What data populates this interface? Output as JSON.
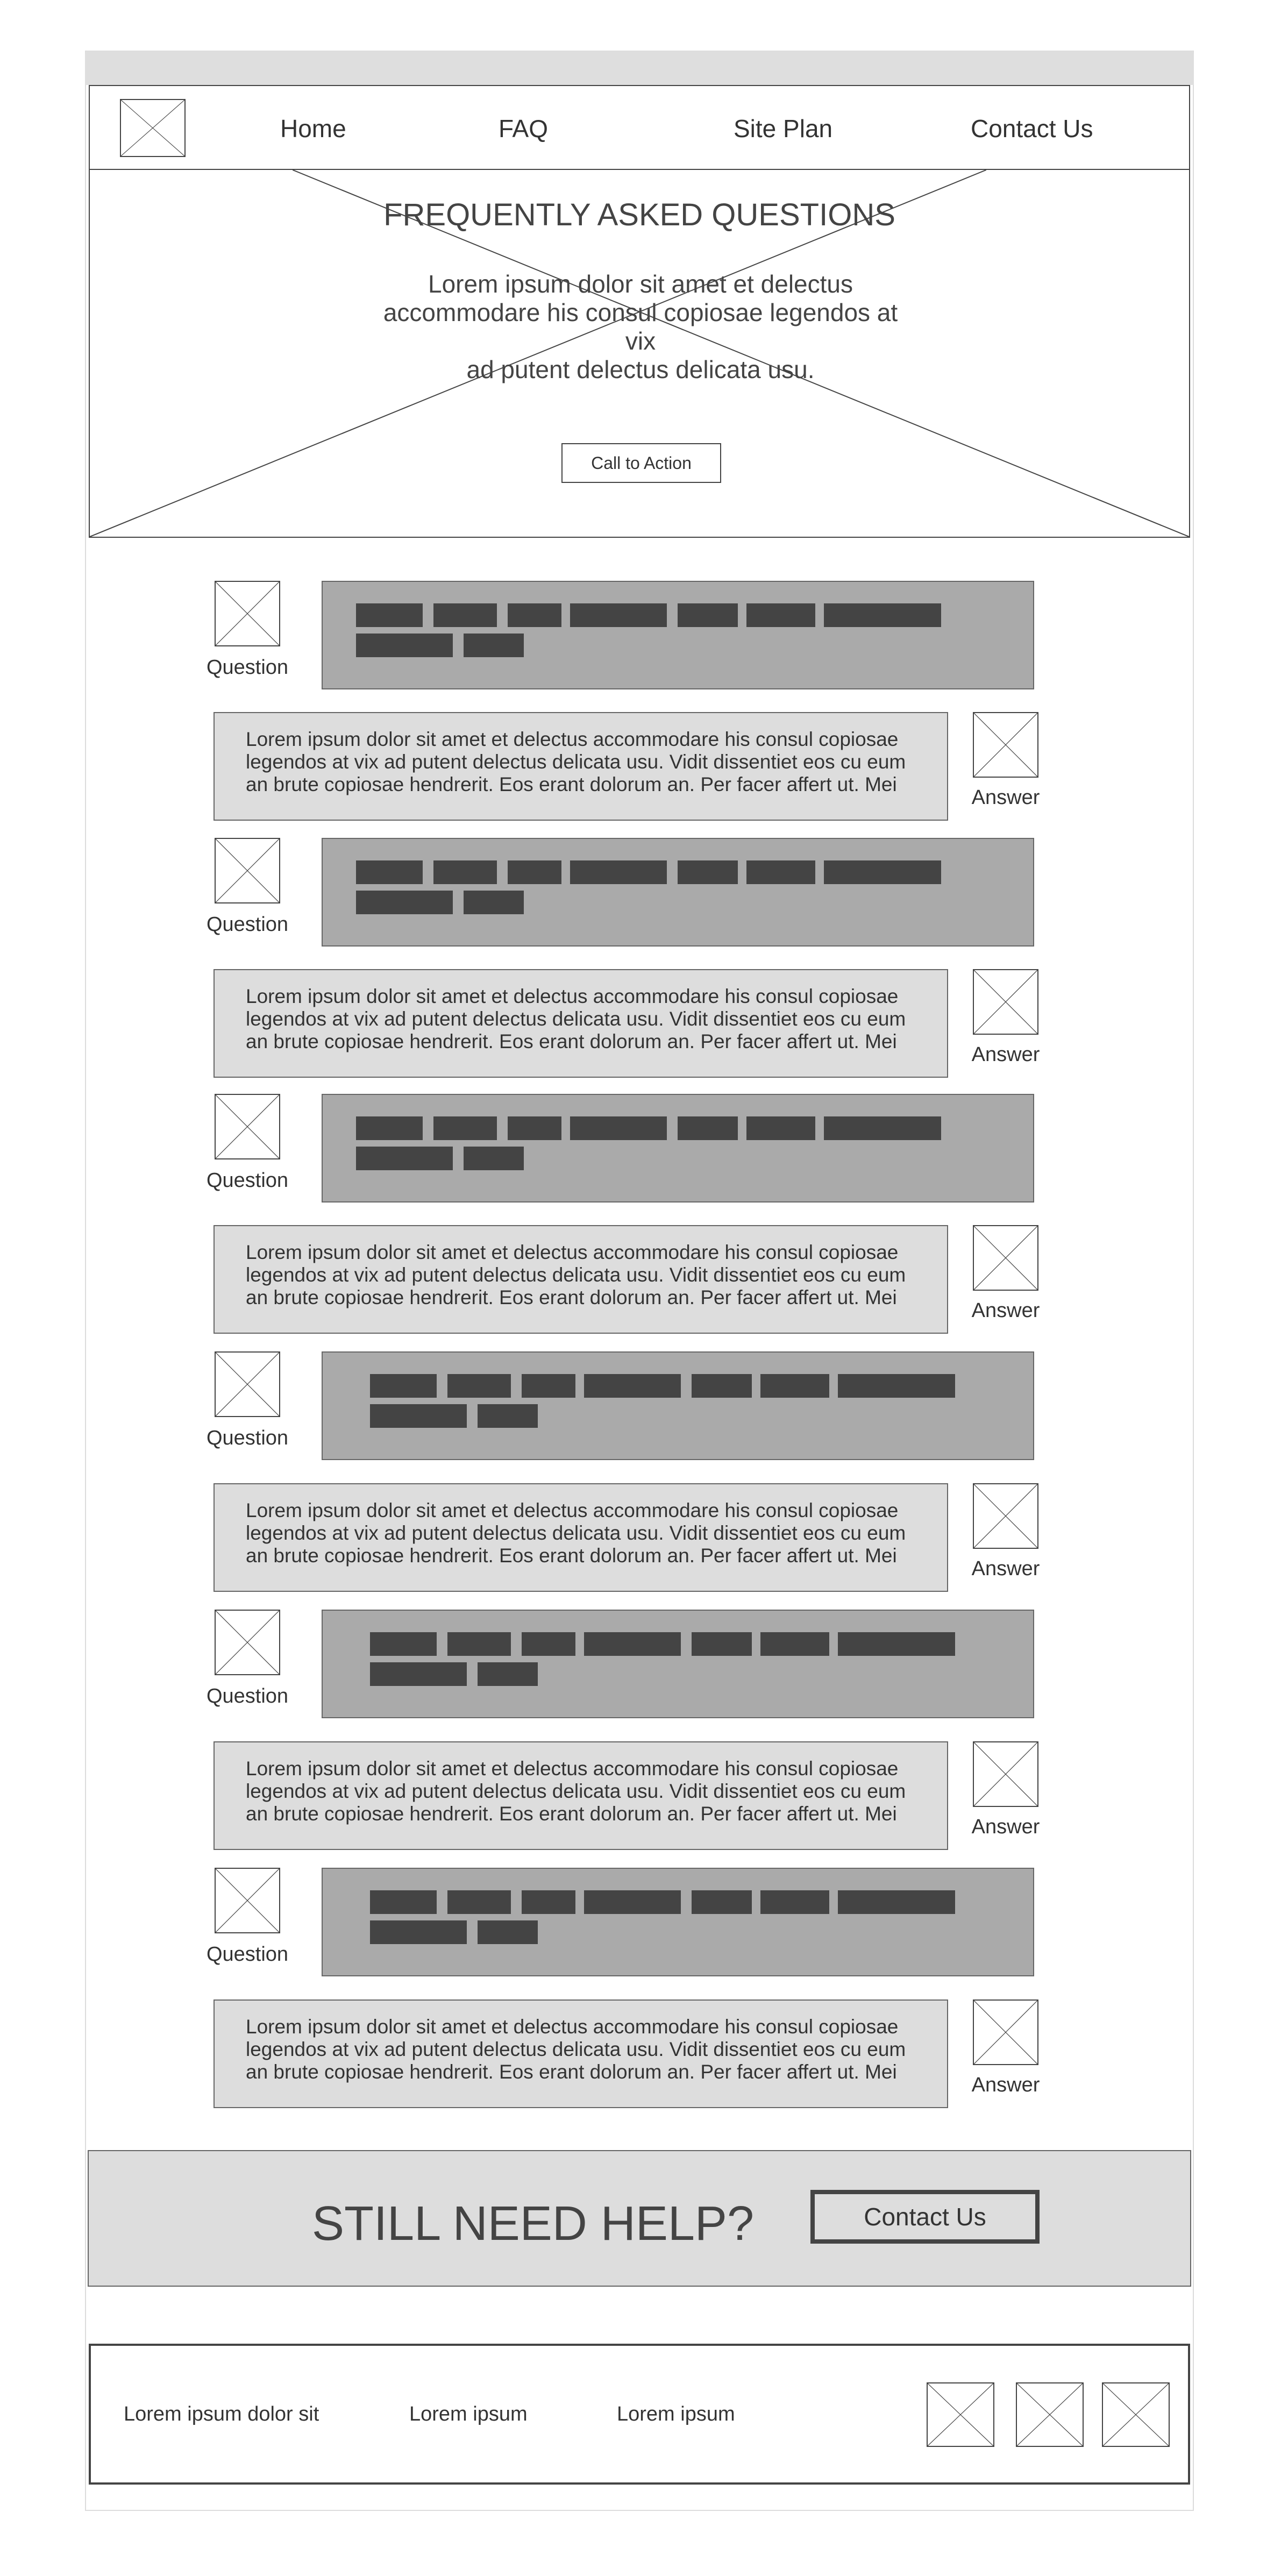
{
  "nav": {
    "logo_icon": "image-placeholder-icon",
    "items": [
      "Home",
      "FAQ",
      "Site Plan",
      "Contact Us"
    ]
  },
  "hero": {
    "title": "FREQUENTLY ASKED QUESTIONS",
    "text_lines": [
      "Lorem ipsum dolor sit amet et delectus",
      "accommodare his consul copiosae legendos at vix",
      "ad putent delectus delicata usu."
    ],
    "cta_label": "Call to Action"
  },
  "faq": {
    "question_caption": "Question",
    "answer_caption": "Answer",
    "answer_lines": [
      "Lorem ipsum dolor sit amet et delectus accommodare his consul copiosae",
      "legendos at vix ad putent delectus delicata usu. Vidit dissentiet eos cu eum",
      "an brute copiosae hendrerit. Eos erant dolorum an. Per facer affert ut. Mei"
    ],
    "count": 6
  },
  "help": {
    "title": "STILL NEED HELP?",
    "button_label": "Contact Us"
  },
  "footer": {
    "links": [
      "Lorem ipsum dolor sit",
      "Lorem ipsum",
      "Lorem ipsum"
    ],
    "social_icons": [
      "image-placeholder-icon",
      "image-placeholder-icon",
      "image-placeholder-icon"
    ]
  },
  "colors": {
    "wireframe_stroke": "#444444",
    "question_fill": "#aaaaaa",
    "answer_fill": "#dddddd",
    "placeholder_bar": "#444444"
  }
}
